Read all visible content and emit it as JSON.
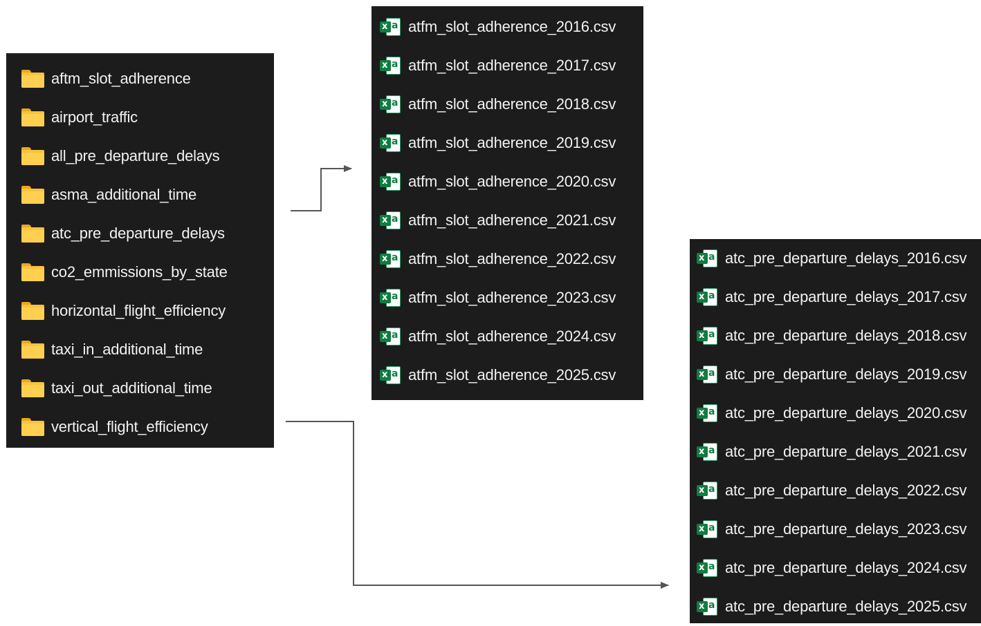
{
  "folders": [
    {
      "label": "aftm_slot_adherence",
      "icon": "folder-icon"
    },
    {
      "label": "airport_traffic",
      "icon": "folder-icon"
    },
    {
      "label": "all_pre_departure_delays",
      "icon": "folder-icon"
    },
    {
      "label": "asma_additional_time",
      "icon": "folder-icon"
    },
    {
      "label": "atc_pre_departure_delays",
      "icon": "folder-icon"
    },
    {
      "label": "co2_emmissions_by_state",
      "icon": "folder-icon"
    },
    {
      "label": "horizontal_flight_efficiency",
      "icon": "folder-icon"
    },
    {
      "label": "taxi_in_additional_time",
      "icon": "folder-icon"
    },
    {
      "label": "taxi_out_additional_time",
      "icon": "folder-icon"
    },
    {
      "label": "vertical_flight_efficiency",
      "icon": "folder-icon"
    }
  ],
  "atfm_files": [
    {
      "label": "atfm_slot_adherence_2016.csv",
      "icon": "excel-csv-icon"
    },
    {
      "label": "atfm_slot_adherence_2017.csv",
      "icon": "excel-csv-icon"
    },
    {
      "label": "atfm_slot_adherence_2018.csv",
      "icon": "excel-csv-icon"
    },
    {
      "label": "atfm_slot_adherence_2019.csv",
      "icon": "excel-csv-icon"
    },
    {
      "label": "atfm_slot_adherence_2020.csv",
      "icon": "excel-csv-icon"
    },
    {
      "label": "atfm_slot_adherence_2021.csv",
      "icon": "excel-csv-icon"
    },
    {
      "label": "atfm_slot_adherence_2022.csv",
      "icon": "excel-csv-icon"
    },
    {
      "label": "atfm_slot_adherence_2023.csv",
      "icon": "excel-csv-icon"
    },
    {
      "label": "atfm_slot_adherence_2024.csv",
      "icon": "excel-csv-icon"
    },
    {
      "label": "atfm_slot_adherence_2025.csv",
      "icon": "excel-csv-icon"
    }
  ],
  "atc_files": [
    {
      "label": "atc_pre_departure_delays_2016.csv",
      "icon": "excel-csv-icon"
    },
    {
      "label": "atc_pre_departure_delays_2017.csv",
      "icon": "excel-csv-icon"
    },
    {
      "label": "atc_pre_departure_delays_2018.csv",
      "icon": "excel-csv-icon"
    },
    {
      "label": "atc_pre_departure_delays_2019.csv",
      "icon": "excel-csv-icon"
    },
    {
      "label": "atc_pre_departure_delays_2020.csv",
      "icon": "excel-csv-icon"
    },
    {
      "label": "atc_pre_departure_delays_2021.csv",
      "icon": "excel-csv-icon"
    },
    {
      "label": "atc_pre_departure_delays_2022.csv",
      "icon": "excel-csv-icon"
    },
    {
      "label": "atc_pre_departure_delays_2023.csv",
      "icon": "excel-csv-icon"
    },
    {
      "label": "atc_pre_departure_delays_2024.csv",
      "icon": "excel-csv-icon"
    },
    {
      "label": "atc_pre_departure_delays_2025.csv",
      "icon": "excel-csv-icon"
    }
  ],
  "colors": {
    "panel_background": "#1c1c1c",
    "text": "#f2f2f2",
    "folder": "#ffd04f",
    "excel_green": "#107c41",
    "connector": "#555555"
  }
}
